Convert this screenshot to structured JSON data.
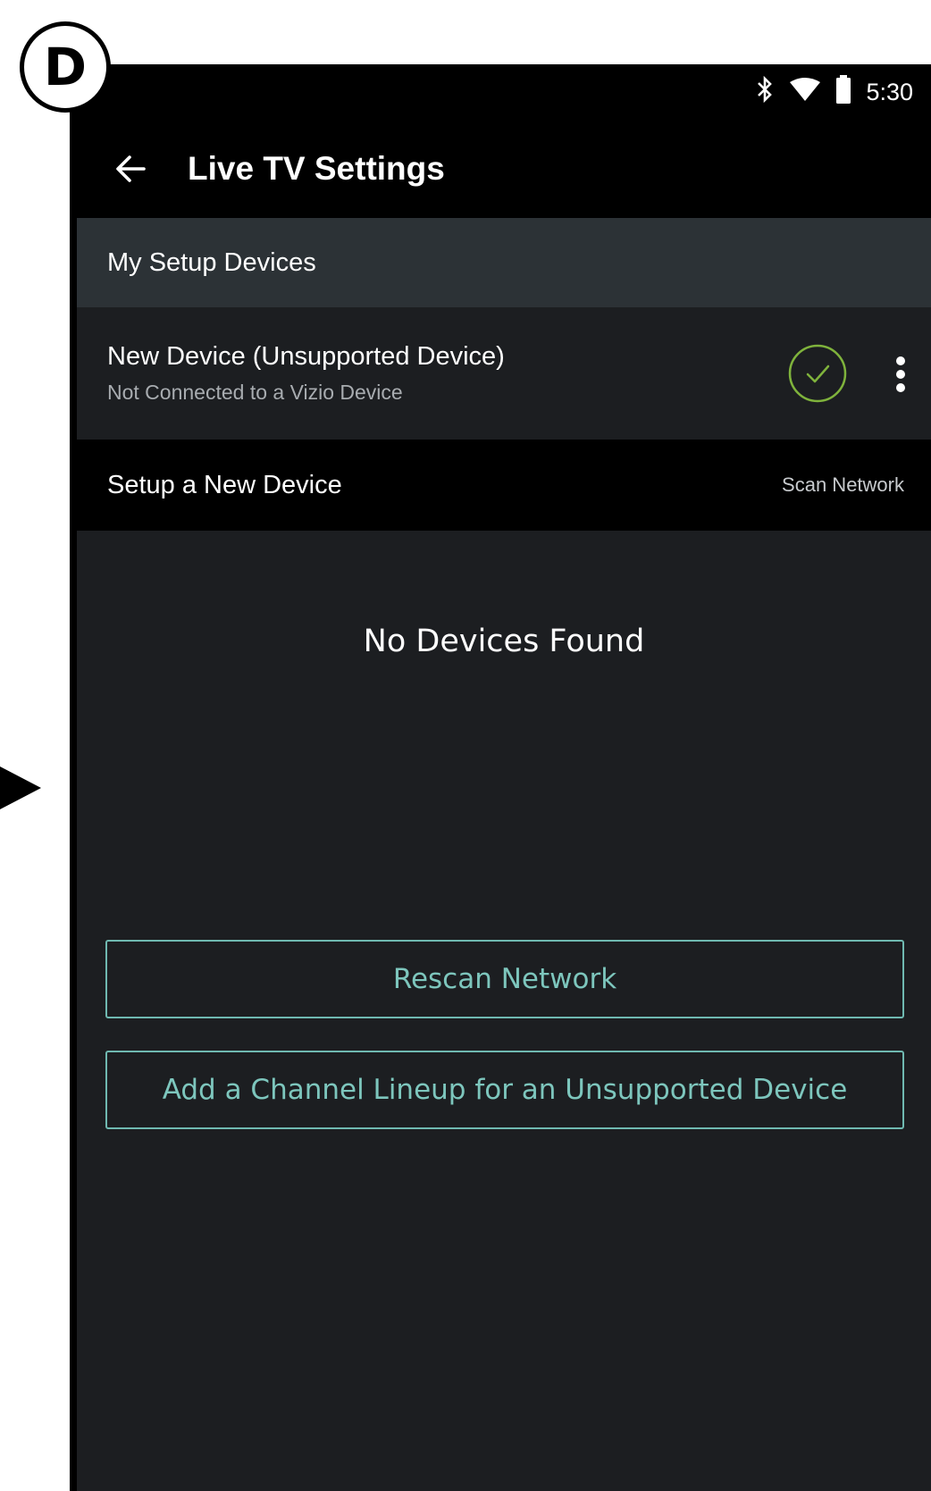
{
  "annotation": {
    "step_letter": "D"
  },
  "status_bar": {
    "icons": [
      "bluetooth-icon",
      "wifi-icon",
      "battery-icon"
    ],
    "time": "5:30"
  },
  "app_bar": {
    "back_icon": "arrow-left-icon",
    "title": "Live TV Settings"
  },
  "my_devices": {
    "header": "My Setup Devices",
    "items": [
      {
        "name": "New Device (Unsupported Device)",
        "subtitle": "Not Connected to a Vizio Device",
        "status_icon": "check-circle-icon",
        "menu_icon": "more-vertical-icon"
      }
    ]
  },
  "setup_new": {
    "label": "Setup a New Device",
    "scan_link": "Scan Network"
  },
  "empty_state": {
    "message": "No Devices Found"
  },
  "actions": {
    "rescan_label": "Rescan Network",
    "add_lineup_label": "Add a Channel Lineup for an Unsupported Device"
  },
  "colors": {
    "accent": "#7dc6bd",
    "check_green": "#7fb33c",
    "header_bg": "#2c3236",
    "content_bg": "#1c1e21"
  }
}
